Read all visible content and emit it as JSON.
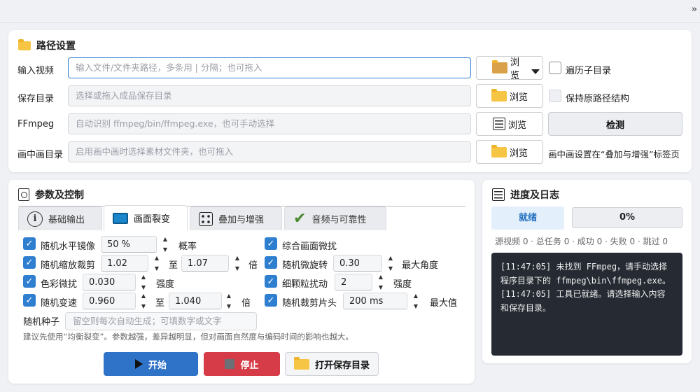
{
  "topbar": {
    "collapse_glyph": "››"
  },
  "path_section": {
    "title": "路径设置",
    "rows": [
      {
        "label": "输入视频",
        "placeholder": "输入文件/文件夹路径，多条用 | 分隔；也可拖入",
        "browse": "浏览",
        "side_checkbox": "遍历子目录"
      },
      {
        "label": "保存目录",
        "placeholder": "选择或拖入成品保存目录",
        "browse": "浏览",
        "side_checkbox": "保持原路径结构"
      },
      {
        "label": "FFmpeg",
        "placeholder": "自动识别 ffmpeg/bin/ffmpeg.exe，也可手动选择",
        "browse": "浏览",
        "side_button": "检测"
      },
      {
        "label": "画中画目录",
        "placeholder": "启用画中画时选择素材文件夹，也可拖入",
        "browse": "浏览",
        "side_note": "画中画设置在“叠加与增强”标签页"
      }
    ]
  },
  "params_section": {
    "title": "参数及控制",
    "tabs": [
      "基础输出",
      "画面裂变",
      "叠加与增强",
      "音频与可靠性"
    ],
    "selected_tab": "画面裂变",
    "left": [
      {
        "label": "随机水平镜像",
        "v1": "50 %",
        "suffix": "概率"
      },
      {
        "label": "随机缩放裁剪",
        "v1": "1.02",
        "mid": "至",
        "v2": "1.07",
        "suffix": "倍"
      },
      {
        "label": "色彩微扰",
        "v1": "0.030",
        "suffix": "强度"
      },
      {
        "label": "随机变速",
        "v1": "0.960",
        "mid": "至",
        "v2": "1.040",
        "suffix": "倍"
      }
    ],
    "right": [
      {
        "label": "综合画面微扰"
      },
      {
        "label": "随机微旋转",
        "v1": "0.30",
        "suffix": "最大角度"
      },
      {
        "label": "细颗粒扰动",
        "v1": "2",
        "suffix": "强度"
      },
      {
        "label": "随机裁剪片头",
        "v1": "200 ms",
        "suffix": "最大值"
      }
    ],
    "seed_label": "随机种子",
    "seed_placeholder": "留空则每次自动生成；可填数字或文字",
    "hint": "建议先使用“均衡裂变”。参数越强，差异越明显，但对画面自然度与编码时间的影响也越大。",
    "start": "开始",
    "stop": "停止",
    "open_dir": "打开保存目录"
  },
  "progress_section": {
    "title": "进度及日志",
    "status": "就绪",
    "percent": "0%",
    "progress_fraction": 0,
    "stats": "源视频 0 · 总任务 0 · 成功 0 · 失败 0 · 跳过 0",
    "log": "[11:47:05] 未找到 FFmpeg，请手动选择程序目录下的 ffmpeg\\bin\\ffmpeg.exe。\n[11:47:05] 工具已就绪。请选择输入内容和保存目录。"
  },
  "colors": {
    "accent": "#2f7fd1",
    "start": "#2f73c8",
    "stop": "#d63c48",
    "log_bg": "#262b33"
  }
}
